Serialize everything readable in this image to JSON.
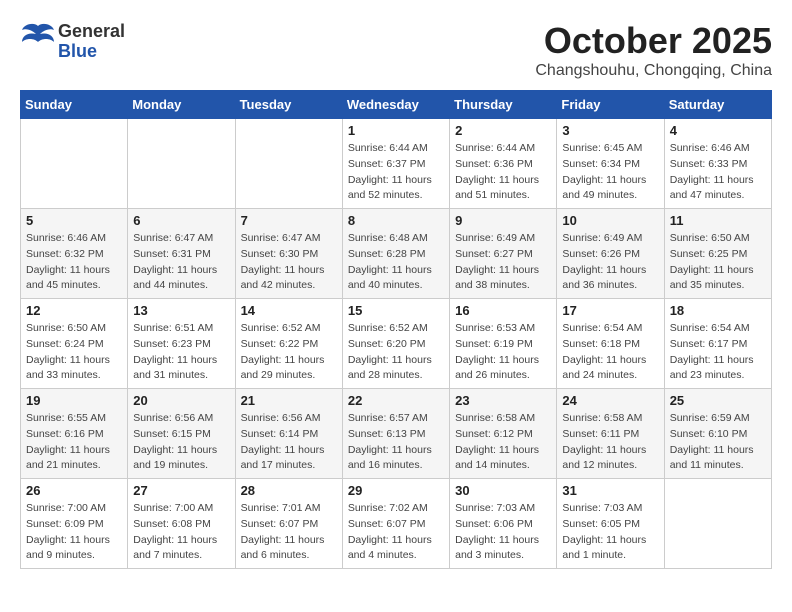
{
  "header": {
    "logo": {
      "general": "General",
      "blue": "Blue"
    },
    "title": "October 2025",
    "subtitle": "Changshouhu, Chongqing, China"
  },
  "weekdays": [
    "Sunday",
    "Monday",
    "Tuesday",
    "Wednesday",
    "Thursday",
    "Friday",
    "Saturday"
  ],
  "weeks": [
    [
      {
        "day": "",
        "sunrise": "",
        "sunset": "",
        "daylight": ""
      },
      {
        "day": "",
        "sunrise": "",
        "sunset": "",
        "daylight": ""
      },
      {
        "day": "",
        "sunrise": "",
        "sunset": "",
        "daylight": ""
      },
      {
        "day": "1",
        "sunrise": "Sunrise: 6:44 AM",
        "sunset": "Sunset: 6:37 PM",
        "daylight": "Daylight: 11 hours and 52 minutes."
      },
      {
        "day": "2",
        "sunrise": "Sunrise: 6:44 AM",
        "sunset": "Sunset: 6:36 PM",
        "daylight": "Daylight: 11 hours and 51 minutes."
      },
      {
        "day": "3",
        "sunrise": "Sunrise: 6:45 AM",
        "sunset": "Sunset: 6:34 PM",
        "daylight": "Daylight: 11 hours and 49 minutes."
      },
      {
        "day": "4",
        "sunrise": "Sunrise: 6:46 AM",
        "sunset": "Sunset: 6:33 PM",
        "daylight": "Daylight: 11 hours and 47 minutes."
      }
    ],
    [
      {
        "day": "5",
        "sunrise": "Sunrise: 6:46 AM",
        "sunset": "Sunset: 6:32 PM",
        "daylight": "Daylight: 11 hours and 45 minutes."
      },
      {
        "day": "6",
        "sunrise": "Sunrise: 6:47 AM",
        "sunset": "Sunset: 6:31 PM",
        "daylight": "Daylight: 11 hours and 44 minutes."
      },
      {
        "day": "7",
        "sunrise": "Sunrise: 6:47 AM",
        "sunset": "Sunset: 6:30 PM",
        "daylight": "Daylight: 11 hours and 42 minutes."
      },
      {
        "day": "8",
        "sunrise": "Sunrise: 6:48 AM",
        "sunset": "Sunset: 6:28 PM",
        "daylight": "Daylight: 11 hours and 40 minutes."
      },
      {
        "day": "9",
        "sunrise": "Sunrise: 6:49 AM",
        "sunset": "Sunset: 6:27 PM",
        "daylight": "Daylight: 11 hours and 38 minutes."
      },
      {
        "day": "10",
        "sunrise": "Sunrise: 6:49 AM",
        "sunset": "Sunset: 6:26 PM",
        "daylight": "Daylight: 11 hours and 36 minutes."
      },
      {
        "day": "11",
        "sunrise": "Sunrise: 6:50 AM",
        "sunset": "Sunset: 6:25 PM",
        "daylight": "Daylight: 11 hours and 35 minutes."
      }
    ],
    [
      {
        "day": "12",
        "sunrise": "Sunrise: 6:50 AM",
        "sunset": "Sunset: 6:24 PM",
        "daylight": "Daylight: 11 hours and 33 minutes."
      },
      {
        "day": "13",
        "sunrise": "Sunrise: 6:51 AM",
        "sunset": "Sunset: 6:23 PM",
        "daylight": "Daylight: 11 hours and 31 minutes."
      },
      {
        "day": "14",
        "sunrise": "Sunrise: 6:52 AM",
        "sunset": "Sunset: 6:22 PM",
        "daylight": "Daylight: 11 hours and 29 minutes."
      },
      {
        "day": "15",
        "sunrise": "Sunrise: 6:52 AM",
        "sunset": "Sunset: 6:20 PM",
        "daylight": "Daylight: 11 hours and 28 minutes."
      },
      {
        "day": "16",
        "sunrise": "Sunrise: 6:53 AM",
        "sunset": "Sunset: 6:19 PM",
        "daylight": "Daylight: 11 hours and 26 minutes."
      },
      {
        "day": "17",
        "sunrise": "Sunrise: 6:54 AM",
        "sunset": "Sunset: 6:18 PM",
        "daylight": "Daylight: 11 hours and 24 minutes."
      },
      {
        "day": "18",
        "sunrise": "Sunrise: 6:54 AM",
        "sunset": "Sunset: 6:17 PM",
        "daylight": "Daylight: 11 hours and 23 minutes."
      }
    ],
    [
      {
        "day": "19",
        "sunrise": "Sunrise: 6:55 AM",
        "sunset": "Sunset: 6:16 PM",
        "daylight": "Daylight: 11 hours and 21 minutes."
      },
      {
        "day": "20",
        "sunrise": "Sunrise: 6:56 AM",
        "sunset": "Sunset: 6:15 PM",
        "daylight": "Daylight: 11 hours and 19 minutes."
      },
      {
        "day": "21",
        "sunrise": "Sunrise: 6:56 AM",
        "sunset": "Sunset: 6:14 PM",
        "daylight": "Daylight: 11 hours and 17 minutes."
      },
      {
        "day": "22",
        "sunrise": "Sunrise: 6:57 AM",
        "sunset": "Sunset: 6:13 PM",
        "daylight": "Daylight: 11 hours and 16 minutes."
      },
      {
        "day": "23",
        "sunrise": "Sunrise: 6:58 AM",
        "sunset": "Sunset: 6:12 PM",
        "daylight": "Daylight: 11 hours and 14 minutes."
      },
      {
        "day": "24",
        "sunrise": "Sunrise: 6:58 AM",
        "sunset": "Sunset: 6:11 PM",
        "daylight": "Daylight: 11 hours and 12 minutes."
      },
      {
        "day": "25",
        "sunrise": "Sunrise: 6:59 AM",
        "sunset": "Sunset: 6:10 PM",
        "daylight": "Daylight: 11 hours and 11 minutes."
      }
    ],
    [
      {
        "day": "26",
        "sunrise": "Sunrise: 7:00 AM",
        "sunset": "Sunset: 6:09 PM",
        "daylight": "Daylight: 11 hours and 9 minutes."
      },
      {
        "day": "27",
        "sunrise": "Sunrise: 7:00 AM",
        "sunset": "Sunset: 6:08 PM",
        "daylight": "Daylight: 11 hours and 7 minutes."
      },
      {
        "day": "28",
        "sunrise": "Sunrise: 7:01 AM",
        "sunset": "Sunset: 6:07 PM",
        "daylight": "Daylight: 11 hours and 6 minutes."
      },
      {
        "day": "29",
        "sunrise": "Sunrise: 7:02 AM",
        "sunset": "Sunset: 6:07 PM",
        "daylight": "Daylight: 11 hours and 4 minutes."
      },
      {
        "day": "30",
        "sunrise": "Sunrise: 7:03 AM",
        "sunset": "Sunset: 6:06 PM",
        "daylight": "Daylight: 11 hours and 3 minutes."
      },
      {
        "day": "31",
        "sunrise": "Sunrise: 7:03 AM",
        "sunset": "Sunset: 6:05 PM",
        "daylight": "Daylight: 11 hours and 1 minute."
      },
      {
        "day": "",
        "sunrise": "",
        "sunset": "",
        "daylight": ""
      }
    ]
  ]
}
